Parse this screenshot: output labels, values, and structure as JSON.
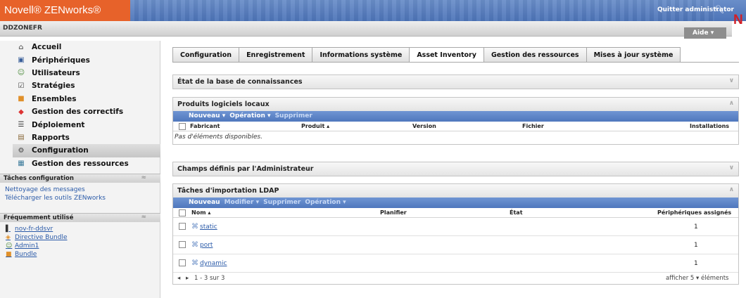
{
  "header": {
    "logo": "Novell® ZENworks®",
    "quit_label": "Quitter administrator",
    "zone": "DDZONEFR",
    "help_label": "Aide ▾",
    "brand_mark": "N"
  },
  "sidebar": {
    "items": [
      {
        "label": "Accueil",
        "icon": "home-icon"
      },
      {
        "label": "Périphériques",
        "icon": "monitor-icon"
      },
      {
        "label": "Utilisateurs",
        "icon": "user-icon"
      },
      {
        "label": "Stratégies",
        "icon": "policy-icon"
      },
      {
        "label": "Ensembles",
        "icon": "bundle-icon"
      },
      {
        "label": "Gestion des correctifs",
        "icon": "patch-icon"
      },
      {
        "label": "Déploiement",
        "icon": "deploy-icon"
      },
      {
        "label": "Rapports",
        "icon": "report-icon"
      },
      {
        "label": "Configuration",
        "icon": "gear-icon",
        "active": true
      },
      {
        "label": "Gestion des ressources",
        "icon": "asset-icon"
      }
    ],
    "config_tasks": {
      "title": "Tâches configuration",
      "links": [
        "Nettoyage des messages",
        "Télécharger les outils ZENworks"
      ]
    },
    "frequent": {
      "title": "Fréquemment utilisé",
      "items": [
        {
          "label": "nov-fr-ddsvr",
          "icon": "server-icon"
        },
        {
          "label": "Directive Bundle",
          "icon": "directive-bundle-icon"
        },
        {
          "label": "Admin1",
          "icon": "user-icon"
        },
        {
          "label": "Bundle",
          "icon": "bundle-icon"
        }
      ]
    }
  },
  "tabs": [
    "Configuration",
    "Enregistrement",
    "Informations système",
    "Asset Inventory",
    "Gestion des ressources",
    "Mises à jour système"
  ],
  "active_tab": "Asset Inventory",
  "panels": {
    "kb": {
      "title": "État de la base de connaissances"
    },
    "local_sw": {
      "title": "Produits logiciels locaux",
      "actions": [
        "Nouveau ▾",
        "Opération ▾",
        "Supprimer"
      ],
      "columns": [
        "Fabricant",
        "Produit ▴",
        "Version",
        "Fichier",
        "Installations"
      ],
      "empty": "Pas d'éléments disponibles."
    },
    "admin_fields": {
      "title": "Champs définis par l'Administrateur"
    },
    "ldap": {
      "title": "Tâches d'importation LDAP",
      "actions": [
        "Nouveau",
        "Modifier ▾",
        "Supprimer",
        "Opération ▾"
      ],
      "columns": [
        "Nom ▴",
        "Planifier",
        "État",
        "Périphériques assignés"
      ],
      "rows": [
        {
          "name": "static",
          "count": "1"
        },
        {
          "name": "port",
          "count": "1"
        },
        {
          "name": "dynamic",
          "count": "1"
        }
      ],
      "pager": {
        "range": "1 - 3 sur 3",
        "show": "afficher 5 ▾ éléments"
      }
    }
  },
  "colors": {
    "logo_orange": "#e7622a",
    "header_blue": "#4d74b8",
    "link_blue": "#2a5aa8",
    "brand_red": "#d31f26"
  }
}
